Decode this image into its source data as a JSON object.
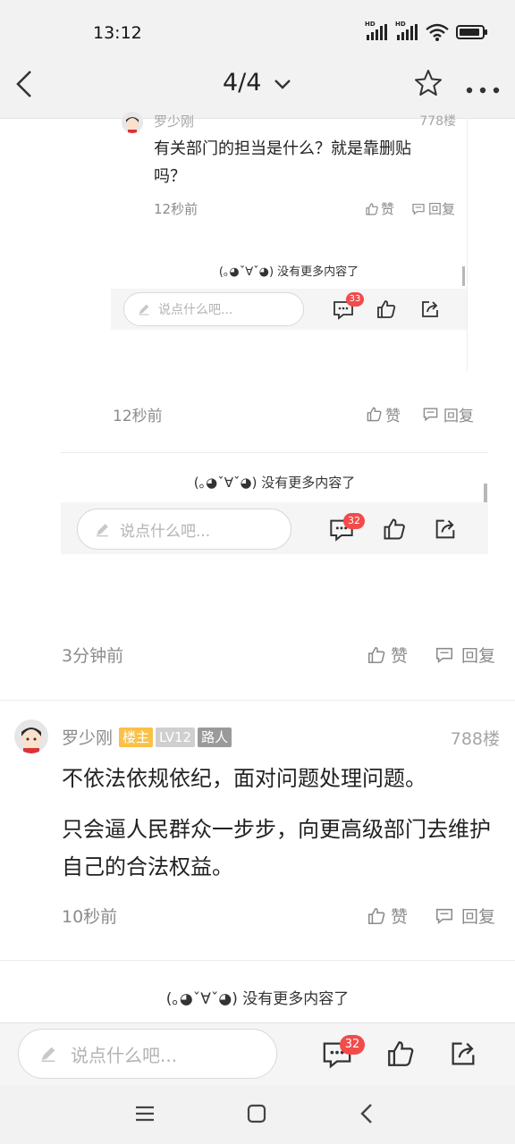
{
  "status_bar": {
    "time": "13:12",
    "hd1": "HD",
    "hd2": "HD"
  },
  "nav": {
    "title": "4/4",
    "back_icon": "back-arrow-icon",
    "dropdown_icon": "chevron-down-icon",
    "star_icon": "star-icon",
    "more_icon": "more-icon"
  },
  "nested_level3": {
    "author_partial": "罗少刚",
    "floor_partial": "778楼",
    "text": "有关部门的担当是什么？就是靠删贴吗？",
    "time": "12秒前",
    "like": "赞",
    "reply": "回复",
    "no_more": "(｡◕ˇ∀ˇ◕) 没有更多内容了",
    "input_placeholder": "说点什么吧...",
    "comment_count": "33"
  },
  "nested_level2": {
    "time": "12秒前",
    "like": "赞",
    "reply": "回复",
    "no_more": "(｡◕ˇ∀ˇ◕) 没有更多内容了",
    "input_placeholder": "说点什么吧...",
    "comment_count": "32"
  },
  "prev_comment": {
    "time": "3分钟前",
    "like": "赞",
    "reply": "回复"
  },
  "main_comment": {
    "author": "罗少刚",
    "badge_host": "楼主",
    "badge_level": "LV12",
    "badge_role": "路人",
    "floor": "788楼",
    "paragraph1": "不依法依规依纪，面对问题处理问题。",
    "paragraph2": "只会逼人民群众一步步，向更高级部门去维护自己的合法权益。",
    "time": "10秒前",
    "like": "赞",
    "reply": "回复"
  },
  "footer": {
    "no_more": "(｡◕ˇ∀ˇ◕) 没有更多内容了"
  },
  "bottom_bar": {
    "input_placeholder": "说点什么吧...",
    "comment_count": "32"
  },
  "colors": {
    "accent_red": "#f24b4b",
    "host_badge": "#f8c14a",
    "text_gray": "#8b8b8b"
  }
}
